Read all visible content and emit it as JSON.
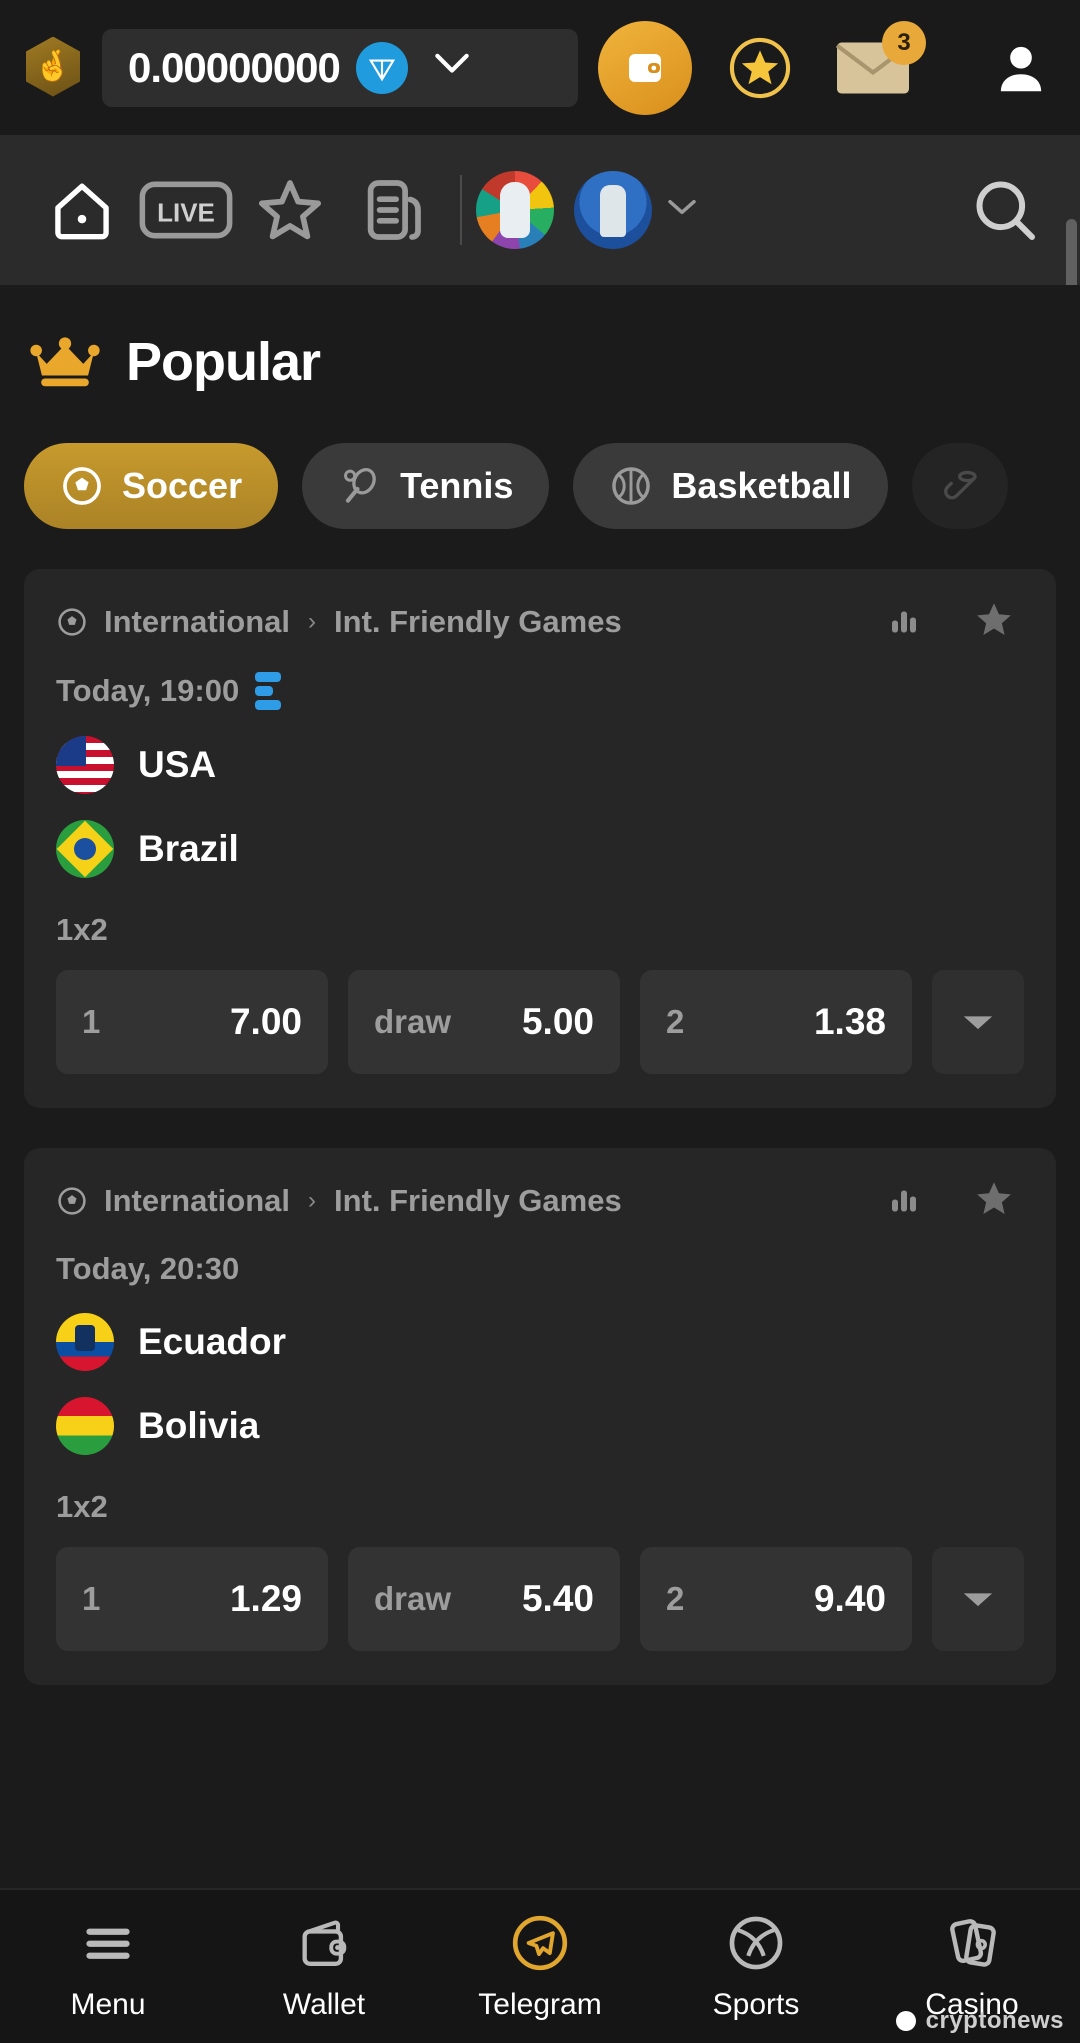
{
  "topbar": {
    "logo_icon": "crossed-fingers-hex-logo",
    "balance": "0.00000000",
    "currency_icon": "ton-coin-icon",
    "dropdown_icon": "chevron-down-icon",
    "wallet_icon": "wallet-icon",
    "bonus_icon": "star-bonus-icon",
    "mail_icon": "envelope-icon",
    "mail_badge": "3",
    "profile_icon": "user-icon"
  },
  "nav": {
    "items": [
      {
        "name": "home",
        "icon": "home-icon",
        "label": ""
      },
      {
        "name": "live",
        "icon": "live-icon",
        "label": "LIVE"
      },
      {
        "name": "favorites",
        "icon": "star-outline-icon",
        "label": ""
      },
      {
        "name": "bets",
        "icon": "bet-slip-icon",
        "label": ""
      }
    ],
    "tournaments": [
      {
        "name": "euro-2024",
        "icon": "euro-trophy-icon"
      },
      {
        "name": "copa-america",
        "icon": "copa-america-trophy-icon"
      }
    ],
    "caret_icon": "chevron-down-icon",
    "search_icon": "search-icon"
  },
  "page": {
    "title": "Popular",
    "title_icon": "crown-icon"
  },
  "sport_chips": [
    {
      "label": "Soccer",
      "icon": "soccer-ball-icon",
      "active": true
    },
    {
      "label": "Tennis",
      "icon": "tennis-racket-icon",
      "active": false
    },
    {
      "label": "Basketball",
      "icon": "basketball-icon",
      "active": false
    },
    {
      "label": "",
      "icon": "hockey-icon",
      "active": false
    }
  ],
  "matches": [
    {
      "league_icon": "soccer-ball-icon",
      "country": "International",
      "separator": "›",
      "league": "Int. Friendly Games",
      "stats_icon": "bar-chart-icon",
      "favorite_icon": "star-filled-icon",
      "time": "Today, 19:00",
      "has_stream": true,
      "stream_icon": "live-stream-icon",
      "home_team": "USA",
      "home_flag": "usa-flag-icon",
      "away_team": "Brazil",
      "away_flag": "brazil-flag-icon",
      "market": "1x2",
      "odds": [
        {
          "key": "1",
          "value": "7.00"
        },
        {
          "key": "draw",
          "value": "5.00"
        },
        {
          "key": "2",
          "value": "1.38"
        }
      ],
      "more_icon": "chevron-down-icon"
    },
    {
      "league_icon": "soccer-ball-icon",
      "country": "International",
      "separator": "›",
      "league": "Int. Friendly Games",
      "stats_icon": "bar-chart-icon",
      "favorite_icon": "star-filled-icon",
      "time": "Today, 20:30",
      "has_stream": false,
      "stream_icon": "",
      "home_team": "Ecuador",
      "home_flag": "ecuador-flag-icon",
      "away_team": "Bolivia",
      "away_flag": "bolivia-flag-icon",
      "market": "1x2",
      "odds": [
        {
          "key": "1",
          "value": "1.29"
        },
        {
          "key": "draw",
          "value": "5.40"
        },
        {
          "key": "2",
          "value": "9.40"
        }
      ],
      "more_icon": "chevron-down-icon"
    }
  ],
  "bottom_nav": [
    {
      "label": "Menu",
      "icon": "hamburger-menu-icon",
      "accent": false
    },
    {
      "label": "Wallet",
      "icon": "wallet-outline-icon",
      "accent": false
    },
    {
      "label": "Telegram",
      "icon": "telegram-icon",
      "accent": true
    },
    {
      "label": "Sports",
      "icon": "sports-ball-icon",
      "accent": false
    },
    {
      "label": "Casino",
      "icon": "casino-cards-icon",
      "accent": false
    }
  ],
  "watermark": {
    "text": "cryptonews",
    "icon": "cryptonews-logo-icon"
  },
  "colors": {
    "accent_gold": "#d9a441",
    "ton_blue": "#1f9bde",
    "stream_blue": "#2f9ce8",
    "bg": "#1b1b1b"
  }
}
